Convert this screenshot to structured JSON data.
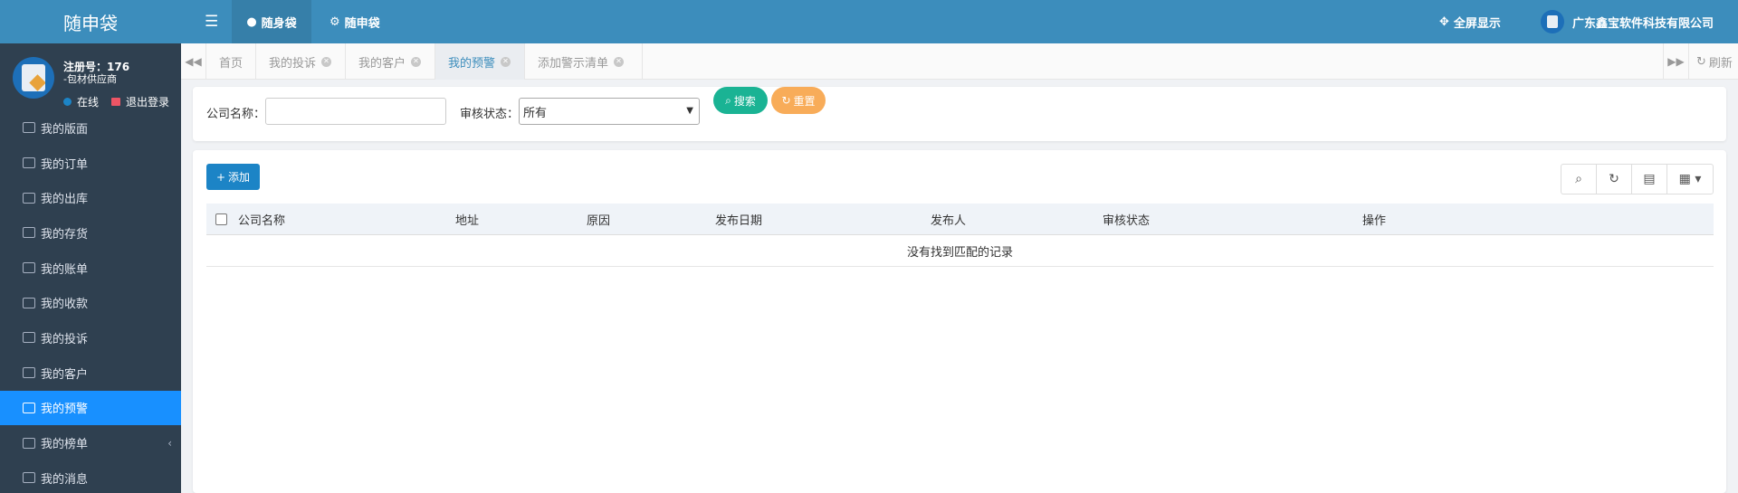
{
  "app": {
    "brand": "随申袋"
  },
  "user": {
    "register_no": "注册号：176",
    "role": "-包材供应商",
    "status": "在线",
    "logout": "退出登录"
  },
  "menu": [
    {
      "label": "我的版面",
      "icon": "layout-icon"
    },
    {
      "label": "我的订单",
      "icon": "monitor-icon"
    },
    {
      "label": "我的出库",
      "icon": "bus-icon"
    },
    {
      "label": "我的存货",
      "icon": "cubes-icon"
    },
    {
      "label": "我的账单",
      "icon": "newspaper-icon"
    },
    {
      "label": "我的收款",
      "icon": "credit-card-icon"
    },
    {
      "label": "我的投诉",
      "icon": "headphones-icon"
    },
    {
      "label": "我的客户",
      "icon": "users-icon"
    },
    {
      "label": "我的预警",
      "icon": "bell-slash-icon",
      "active": true
    },
    {
      "label": "我的榜单",
      "icon": "bar-chart-icon",
      "has_children": true
    },
    {
      "label": "我的消息",
      "icon": "globe-icon"
    }
  ],
  "topbar": {
    "tab1": "随身袋",
    "tab2": "随申袋",
    "fullscreen": "全屏显示",
    "company": "广东鑫宝软件科技有限公司"
  },
  "page_tabs": [
    {
      "label": "首页",
      "closable": false
    },
    {
      "label": "我的投诉",
      "closable": true
    },
    {
      "label": "我的客户",
      "closable": true
    },
    {
      "label": "我的预警",
      "closable": true,
      "active": true
    },
    {
      "label": "添加警示清单",
      "closable": true
    }
  ],
  "refresh": "刷新",
  "search": {
    "company_label": "公司名称：",
    "company_value": "",
    "status_label": "审核状态：",
    "status_value": "所有",
    "search_btn": "搜索",
    "reset_btn": "重置"
  },
  "table": {
    "add_btn": "添加",
    "columns": [
      "公司名称",
      "地址",
      "原因",
      "发布日期",
      "发布人",
      "审核状态",
      "操作"
    ],
    "empty": "没有找到匹配的记录"
  },
  "colors": {
    "primary": "#3c8dbc",
    "sidebar": "#2f4050",
    "active_menu": "#1890ff",
    "search_btn": "#1ab394",
    "reset_btn": "#f8ac59"
  }
}
